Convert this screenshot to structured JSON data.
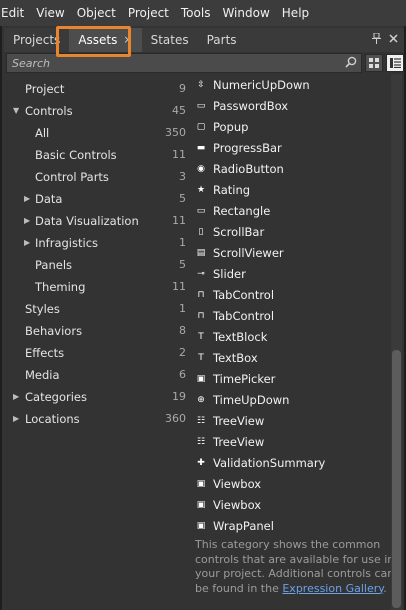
{
  "menu": [
    "Edit",
    "View",
    "Object",
    "Project",
    "Tools",
    "Window",
    "Help"
  ],
  "tabs": {
    "projects": "Projects",
    "assets": "Assets",
    "assets_close": "×",
    "states": "States",
    "parts": "Parts"
  },
  "search": {
    "placeholder": "Search"
  },
  "categories": [
    {
      "label": "Project",
      "count": "9"
    },
    {
      "label": "Controls",
      "count": "45"
    },
    {
      "label": "All",
      "count": "350"
    },
    {
      "label": "Basic Controls",
      "count": "11"
    },
    {
      "label": "Control Parts",
      "count": "3"
    },
    {
      "label": "Data",
      "count": "5"
    },
    {
      "label": "Data Visualization",
      "count": "11"
    },
    {
      "label": "Infragistics",
      "count": "1"
    },
    {
      "label": "Panels",
      "count": "5"
    },
    {
      "label": "Theming",
      "count": "11"
    },
    {
      "label": "Styles",
      "count": "1"
    },
    {
      "label": "Behaviors",
      "count": "8"
    },
    {
      "label": "Effects",
      "count": "2"
    },
    {
      "label": "Media",
      "count": "6"
    },
    {
      "label": "Categories",
      "count": "19"
    },
    {
      "label": "Locations",
      "count": "360"
    }
  ],
  "assets": [
    {
      "label": "NumericUpDown",
      "icon": "numeric-updown-icon"
    },
    {
      "label": "PasswordBox",
      "icon": "passwordbox-icon"
    },
    {
      "label": "Popup",
      "icon": "popup-icon"
    },
    {
      "label": "ProgressBar",
      "icon": "progressbar-icon"
    },
    {
      "label": "RadioButton",
      "icon": "radiobutton-icon"
    },
    {
      "label": "Rating",
      "icon": "rating-icon"
    },
    {
      "label": "Rectangle",
      "icon": "rectangle-icon"
    },
    {
      "label": "ScrollBar",
      "icon": "scrollbar-icon"
    },
    {
      "label": "ScrollViewer",
      "icon": "scrollviewer-icon"
    },
    {
      "label": "Slider",
      "icon": "slider-icon"
    },
    {
      "label": "TabControl",
      "icon": "tabcontrol-icon"
    },
    {
      "label": "TabControl",
      "icon": "tabcontrol-icon"
    },
    {
      "label": "TextBlock",
      "icon": "textblock-icon"
    },
    {
      "label": "TextBox",
      "icon": "textbox-icon"
    },
    {
      "label": "TimePicker",
      "icon": "timepicker-icon"
    },
    {
      "label": "TimeUpDown",
      "icon": "timeupdown-icon"
    },
    {
      "label": "TreeView",
      "icon": "treeview-icon"
    },
    {
      "label": "TreeView",
      "icon": "treeview-icon"
    },
    {
      "label": "ValidationSummary",
      "icon": "validationsummary-icon"
    },
    {
      "label": "Viewbox",
      "icon": "viewbox-icon"
    },
    {
      "label": "Viewbox",
      "icon": "viewbox-icon"
    },
    {
      "label": "WrapPanel",
      "icon": "wrappanel-icon"
    }
  ],
  "info": {
    "text": "This category shows the common controls that are available for use in your project. Additional controls can be found in the ",
    "link": "Expression Gallery",
    "end": "."
  },
  "colors": {
    "highlight_border": "#e8852e",
    "link": "#6ca2e8",
    "panel_background": "#333333"
  }
}
